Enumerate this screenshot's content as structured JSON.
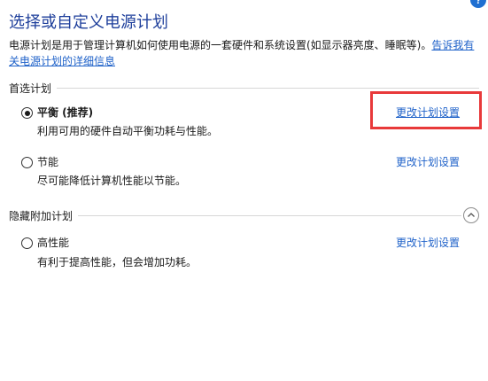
{
  "header": {
    "title": "选择或自定义电源计划",
    "intro_text": "电源计划是用于管理计算机如何使用电源的一套硬件和系统设置(如显示器亮度、睡眠等)。",
    "intro_link": "告诉我有关电源计划的详细信息",
    "help_glyph": "?"
  },
  "preferred_group": {
    "label": "首选计划",
    "plans": [
      {
        "name": "平衡 (推荐)",
        "description": "利用可用的硬件自动平衡功耗与性能。",
        "link": "更改计划设置",
        "selected": true
      },
      {
        "name": "节能",
        "description": "尽可能降低计算机性能以节能。",
        "link": "更改计划设置",
        "selected": false
      }
    ]
  },
  "hidden_group": {
    "label": "隐藏附加计划",
    "collapse_icon": "chevron-up-icon",
    "plans": [
      {
        "name": "高性能",
        "description": "有利于提高性能，但会增加功耗。",
        "link": "更改计划设置",
        "selected": false
      }
    ]
  },
  "colors": {
    "title": "#1e3f9b",
    "link": "#1f62c9",
    "highlight": "#e8393a",
    "help_icon": "#1f6fd1"
  }
}
